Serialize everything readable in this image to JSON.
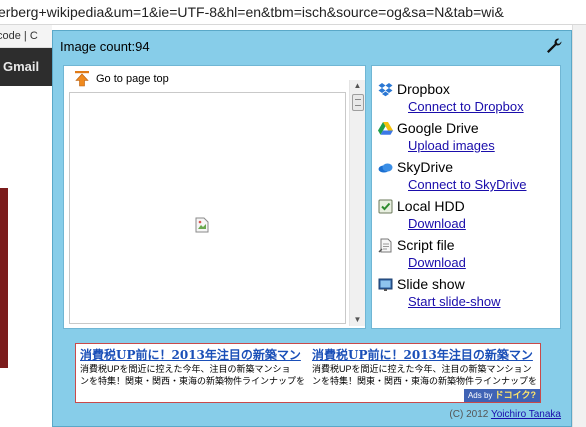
{
  "browser": {
    "url_text": "erberg+wikipedia&um=1&ie=UTF-8&hl=en&tbm=isch&source=og&sa=N&tab=wi&",
    "bookmark_text": "code | C",
    "gbar_label": "Gmail"
  },
  "popup": {
    "image_count_label": "Image count:94",
    "settings_icon": "wrench-icon",
    "go_to_top_label": "Go to page top",
    "services": [
      {
        "name": "Dropbox",
        "icon": "dropbox-icon",
        "link": "Connect to Dropbox"
      },
      {
        "name": "Google Drive",
        "icon": "google-drive-icon",
        "link": "Upload images"
      },
      {
        "name": "SkyDrive",
        "icon": "skydrive-icon",
        "link": "Connect to SkyDrive"
      },
      {
        "name": "Local HDD",
        "icon": "local-hdd-icon",
        "link": "Download"
      },
      {
        "name": "Script file",
        "icon": "script-file-icon",
        "link": "Download"
      },
      {
        "name": "Slide show",
        "icon": "slide-show-icon",
        "link": "Start slide-show"
      }
    ],
    "ad": {
      "headline_1": "消費税UP前に！2013年注目の新築マン",
      "body_1a": "消費税UPを間近に控えた今年、注目の新築マンショ",
      "body_1b": "ンを特集！関東・関西・東海の新築物件ラインナップを",
      "headline_2": "消費税UP前に！2013年注目の新築マン",
      "body_2a": "消費税UPを間近に控えた今年、注目の新築マンション",
      "body_2b": "ンを特集！関東・関西・東海の新築物件ラインナップを",
      "badge_prefix": "Ads by",
      "badge_brand": "ドコイク?"
    },
    "footer": {
      "copyright": "(C) 2012",
      "author": "Yoichiro Tanaka"
    }
  },
  "colors": {
    "popup_bg": "#87cde9",
    "link": "#1a0dab",
    "ad_border": "#c94a4a"
  }
}
